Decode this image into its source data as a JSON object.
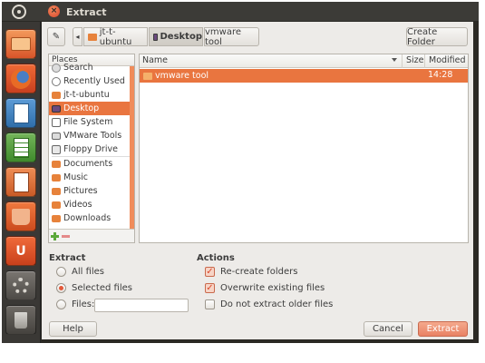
{
  "window": {
    "title": "Extract",
    "close_glyph": "×"
  },
  "pathbar": {
    "crumbs": [
      "jt-t-ubuntu",
      "Desktop",
      "vmware tool"
    ],
    "scroll_left_glyph": "◂",
    "edit_glyph": "✎",
    "create_folder_label": "Create Folder"
  },
  "places": {
    "header": "Places",
    "items": [
      {
        "label": "Search",
        "icon": "search-icon"
      },
      {
        "label": "Recently Used",
        "icon": "recent-icon"
      },
      {
        "label": "jt-t-ubuntu",
        "icon": "home-folder-icon"
      },
      {
        "label": "Desktop",
        "icon": "desktop-icon",
        "selected": true
      },
      {
        "label": "File System",
        "icon": "filesystem-icon"
      },
      {
        "label": "VMware Tools",
        "icon": "disk-icon"
      },
      {
        "label": "Floppy Drive",
        "icon": "floppy-icon"
      },
      {
        "label": "Documents",
        "icon": "folder-icon"
      },
      {
        "label": "Music",
        "icon": "music-icon"
      },
      {
        "label": "Pictures",
        "icon": "pictures-icon"
      },
      {
        "label": "Videos",
        "icon": "videos-icon"
      },
      {
        "label": "Downloads",
        "icon": "downloads-icon"
      }
    ]
  },
  "files": {
    "columns": {
      "name": "Name",
      "size": "Size",
      "modified": "Modified"
    },
    "rows": [
      {
        "name": "vmware tool",
        "size": "",
        "modified": "14:28",
        "selected": true
      }
    ]
  },
  "extract": {
    "title": "Extract",
    "options": [
      "All files",
      "Selected files",
      "Files:"
    ],
    "selected": "Selected files",
    "files_value": ""
  },
  "actions": {
    "title": "Actions",
    "options": [
      {
        "label": "Re-create folders",
        "checked": true
      },
      {
        "label": "Overwrite existing files",
        "checked": true
      },
      {
        "label": "Do not extract older files",
        "checked": false
      }
    ]
  },
  "buttons": {
    "help": "Help",
    "cancel": "Cancel",
    "extract": "Extract"
  },
  "colors": {
    "accent": "#e9753f",
    "titlebar": "#3c3b37",
    "dialog_bg": "#edebe8"
  }
}
